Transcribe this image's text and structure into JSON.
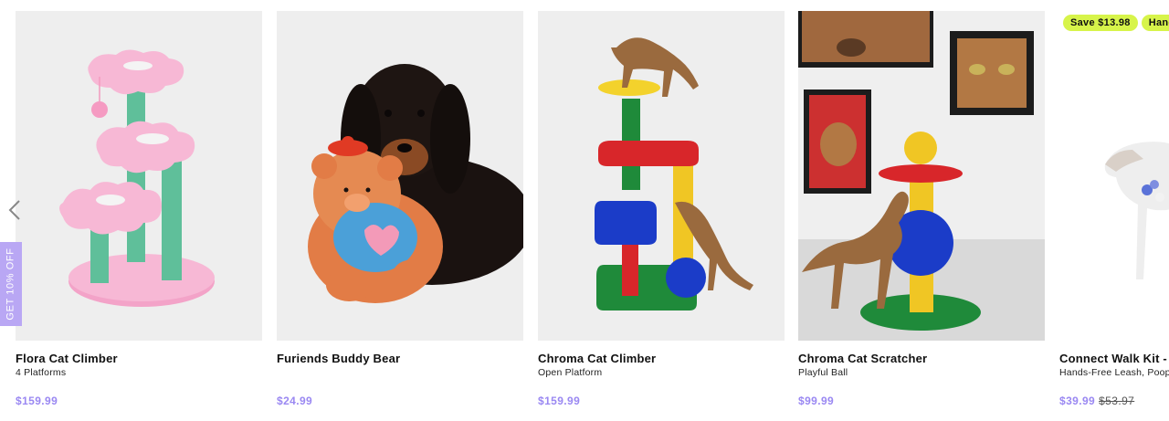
{
  "products": [
    {
      "title": "Flora Cat Climber",
      "subtitle": "4 Platforms",
      "price": "$159.99",
      "image_icon": "flora-cat-climber-image"
    },
    {
      "title": "Furiends Buddy Bear",
      "subtitle": "",
      "price": "$24.99",
      "image_icon": "buddy-bear-image"
    },
    {
      "title": "Chroma Cat Climber",
      "subtitle": "Open Platform",
      "price": "$159.99",
      "image_icon": "chroma-cat-climber-image"
    },
    {
      "title": "Chroma Cat Scratcher",
      "subtitle": "Playful Ball",
      "price": "$99.99",
      "image_icon": "chroma-cat-scratcher-image"
    },
    {
      "title": "Connect Walk Kit -",
      "subtitle": "Hands-Free Leash, Poop Bag Clip",
      "price": "$39.99",
      "compare_price": "$53.97",
      "badges": [
        "Save $13.98",
        "Hands"
      ],
      "image_icon": "walk-kit-image"
    }
  ],
  "promo_tab": {
    "label": "GET 10% OFF"
  },
  "nav": {
    "prev_icon": "chevron-left-icon"
  },
  "colors": {
    "price": "#9a88f2",
    "badge": "#d7f44a",
    "promo": "#b9a7f4",
    "card_bg": "#eeeeee"
  }
}
